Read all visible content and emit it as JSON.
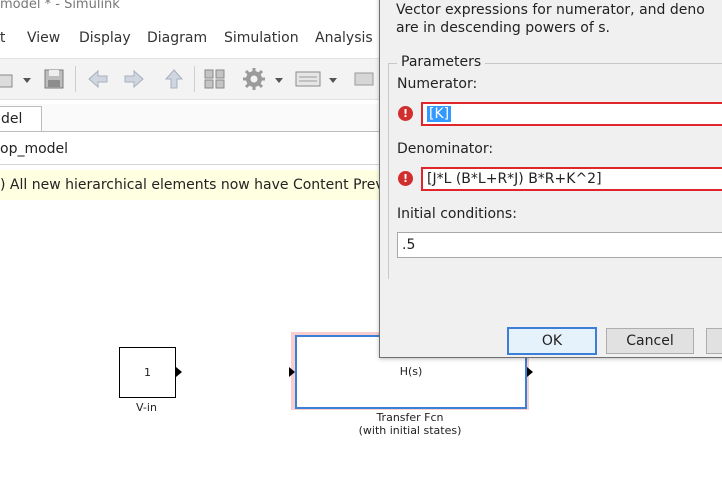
{
  "window": {
    "title": "model * - Simulink"
  },
  "menu": [
    "it",
    "View",
    "Display",
    "Diagram",
    "Simulation",
    "Analysis"
  ],
  "tabs": [
    {
      "label": "del"
    }
  ],
  "breadcrumb": "op_model",
  "banner": {
    "text": ") All new hierarchical elements now have Content Preview"
  },
  "blocks": {
    "vin": {
      "value": "1",
      "label": "V-in"
    },
    "tf": {
      "value": "H(s)",
      "label_line1": "Transfer Fcn",
      "label_line2": "(with initial states)"
    }
  },
  "dialog": {
    "desc_line1": "Vector expressions for numerator, and deno",
    "desc_line2": "are in descending powers of s.",
    "params_title": "Parameters",
    "numerator_label": "Numerator:",
    "numerator_value": "[K]",
    "denominator_label": "Denominator:",
    "denominator_value": "[J*L (B*L+R*J) B*R+K^2]",
    "ic_label": "Initial conditions:",
    "ic_value": ".5",
    "ok_label": "OK",
    "cancel_label": "Cancel"
  },
  "colors": {
    "error": "#e0252b",
    "selection": "#3399ff",
    "banner": "#ffffe1",
    "highlight": "#f4a6a6",
    "focus": "#3c7fd6"
  }
}
